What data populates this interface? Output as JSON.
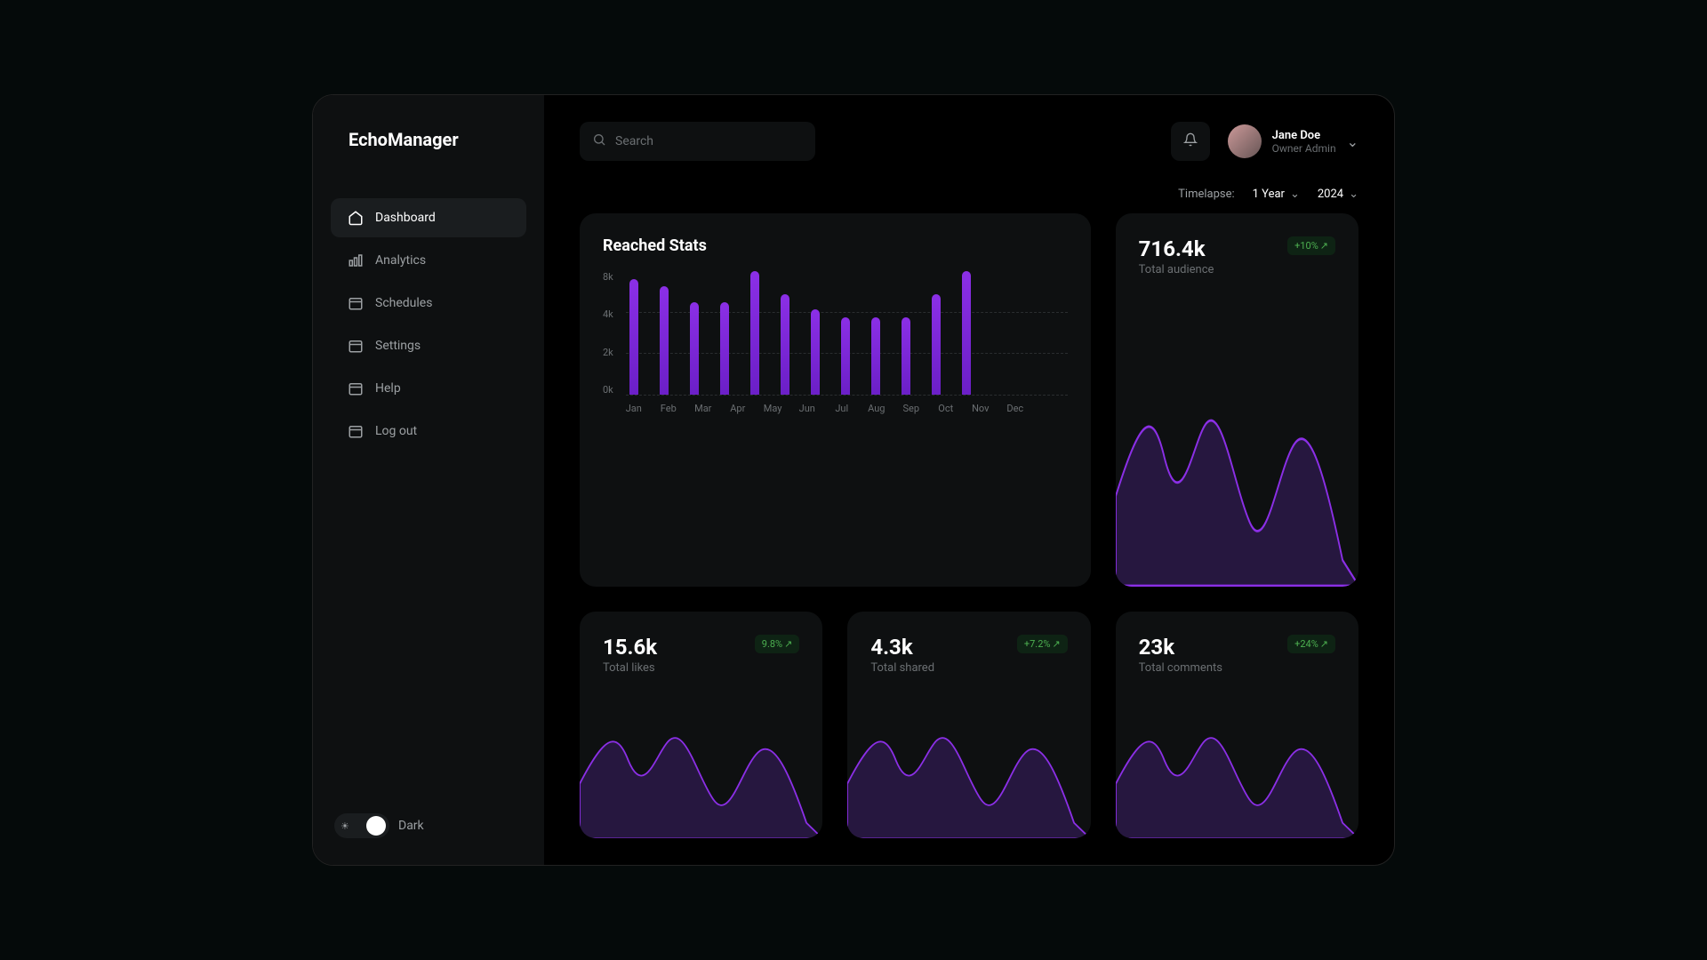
{
  "app_name": "EchoManager",
  "sidebar": {
    "items": [
      {
        "label": "Dashboard",
        "icon": "home-icon",
        "active": true
      },
      {
        "label": "Analytics",
        "icon": "chart-icon",
        "active": false
      },
      {
        "label": "Schedules",
        "icon": "calendar-icon",
        "active": false
      },
      {
        "label": "Settings",
        "icon": "calendar-icon",
        "active": false
      },
      {
        "label": "Help",
        "icon": "calendar-icon",
        "active": false
      },
      {
        "label": "Log out",
        "icon": "calendar-icon",
        "active": false
      }
    ],
    "theme_label": "Dark"
  },
  "search": {
    "placeholder": "Search"
  },
  "user": {
    "name": "Jane Doe",
    "role": "Owner Admin"
  },
  "filters": {
    "label": "Timelapse:",
    "range": "1 Year",
    "year": "2024"
  },
  "cards": {
    "reached": {
      "title": "Reached Stats"
    },
    "audience": {
      "value": "716.4k",
      "label": "Total audience",
      "delta": "+10% "
    },
    "likes": {
      "value": "15.6k",
      "label": "Total likes",
      "delta": "9.8% "
    },
    "shared": {
      "value": "4.3k",
      "label": "Total shared",
      "delta": "+7.2%"
    },
    "comments": {
      "value": "23k",
      "label": "Total comments",
      "delta": "+24% "
    }
  },
  "chart_data": {
    "type": "bar",
    "title": "Reached Stats",
    "categories": [
      "Jan",
      "Feb",
      "Mar",
      "Apr",
      "May",
      "Jun",
      "Jul",
      "Aug",
      "Sep",
      "Oct",
      "Nov",
      "Dec"
    ],
    "values": [
      7500,
      7000,
      6000,
      6000,
      8000,
      6500,
      5500,
      5000,
      5000,
      5000,
      6500,
      8000
    ],
    "y_ticks": [
      "8k",
      "4k",
      "2k",
      "0k"
    ],
    "ylim": [
      0,
      8000
    ],
    "xlabel": "",
    "ylabel": ""
  },
  "colors": {
    "accent": "#8B2FE6",
    "bg_card": "#0E1011",
    "positive": "#4CAF50"
  }
}
